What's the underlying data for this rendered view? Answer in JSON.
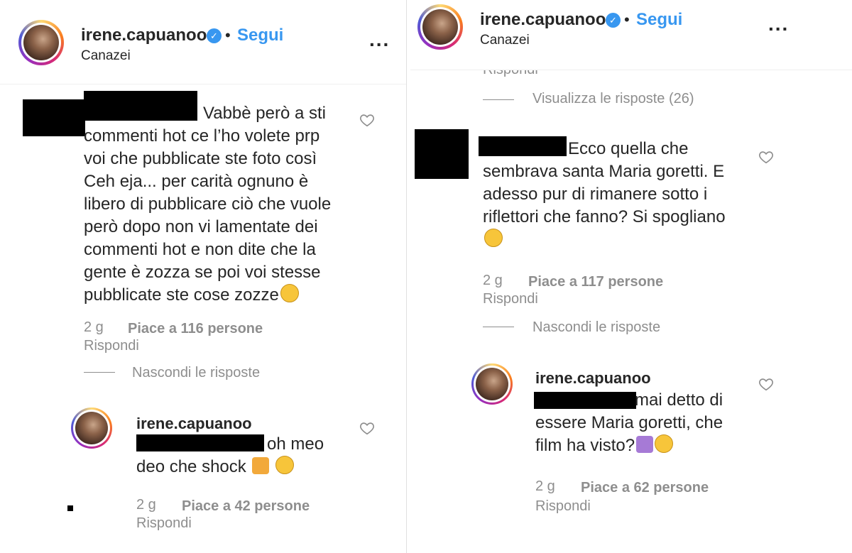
{
  "left": {
    "header": {
      "username": "irene.capuanoo",
      "separator": "•",
      "follow_label": "Segui",
      "location": "Canazei",
      "more_label": "..."
    },
    "comment": {
      "lines": [
        "Vabbè però a sti",
        "commenti hot ce l’ho volete prp",
        "voi che pubblicate ste foto così",
        "Ceh eja... per carità ognuno è",
        "libero di pubblicare ciò che vuole",
        "però dopo non vi lamentate dei",
        "commenti hot e non dite che la",
        "gente è zozza se poi voi stesse",
        "pubblicate ste cose zozze"
      ],
      "time": "2 g",
      "likes": "Piace a 116 persone",
      "reply_label": "Rispondi",
      "hide_replies_label": "Nascondi le risposte"
    },
    "reply": {
      "username": "irene.capuanoo",
      "line1": "oh meo",
      "line2": "deo che shock",
      "time": "2 g",
      "likes": "Piace a 42 persone",
      "reply_label": "Rispondi"
    }
  },
  "right": {
    "header": {
      "username": "irene.capuanoo",
      "separator": "•",
      "follow_label": "Segui",
      "location": "Canazei",
      "more_label": "..."
    },
    "cut_text": "Rispondi",
    "view_replies_label": "Visualizza le risposte (26)",
    "comment": {
      "lines": [
        "Ecco quella che",
        "sembrava santa Maria goretti. E",
        "adesso pur di rimanere sotto i",
        "riflettori che fanno? Si spogliano"
      ],
      "time": "2 g",
      "likes": "Piace a 117 persone",
      "reply_label": "Rispondi",
      "hide_replies_label": "Nascondi le risposte"
    },
    "reply": {
      "username": "irene.capuanoo",
      "line1": "mai detto di",
      "line2": "essere Maria goretti, che",
      "line3": "film ha visto?",
      "time": "2 g",
      "likes": "Piace a 62 persone",
      "reply_label": "Rispondi"
    }
  },
  "icons": {
    "heart": "heart-outline-icon",
    "verified": "verified-badge-icon",
    "emoji_wink": "winking-face-icon",
    "emoji_roll": "face-with-rolling-eyes-icon",
    "emoji_shock": "weary-cat-icon",
    "emoji_woman": "woman-facepalming-icon",
    "emoji_flush": "flushed-face-icon"
  },
  "colors": {
    "link_blue": "#3897f0",
    "muted": "#8e8e8e",
    "text": "#262626"
  }
}
